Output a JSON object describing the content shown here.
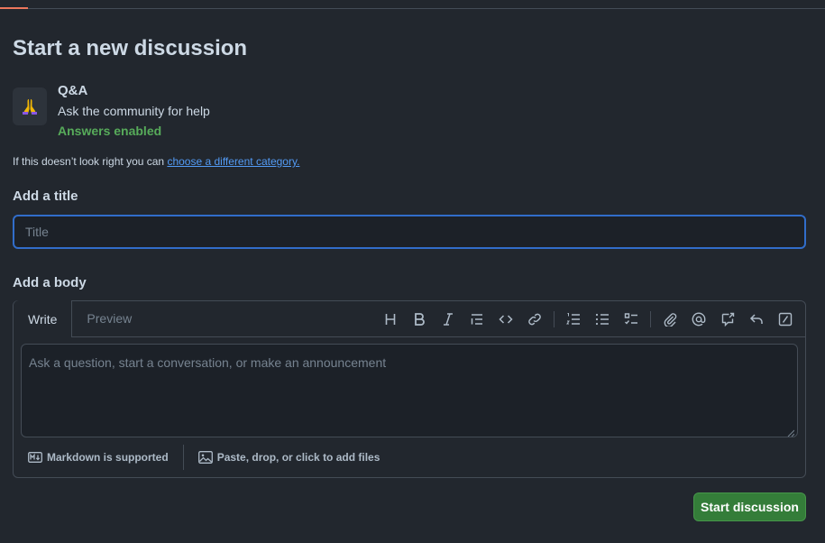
{
  "header": {
    "title": "Start a new discussion"
  },
  "category": {
    "name": "Q&A",
    "description": "Ask the community for help",
    "answers_status": "Answers enabled",
    "emoji": "🙏"
  },
  "hint": {
    "prefix": "If this doesn’t look right you can ",
    "link": "choose a different category."
  },
  "title_section": {
    "label": "Add a title",
    "placeholder": "Title",
    "value": ""
  },
  "body_section": {
    "label": "Add a body",
    "tabs": [
      {
        "label": "Write",
        "active": true
      },
      {
        "label": "Preview",
        "active": false
      }
    ],
    "placeholder": "Ask a question, start a conversation, or make an announcement",
    "value": "",
    "toolbar_icons": [
      "heading-icon",
      "bold-icon",
      "italic-icon",
      "quote-icon",
      "code-icon",
      "link-icon",
      "ordered-list-icon",
      "unordered-list-icon",
      "task-list-icon",
      "attach-icon",
      "mention-icon",
      "reference-icon",
      "reply-icon",
      "slash-command-icon"
    ],
    "markdown_note": "Markdown is supported",
    "files_note": "Paste, drop, or click to add files"
  },
  "submit": {
    "label": "Start discussion"
  },
  "colors": {
    "background": "#22272e",
    "accent_blue": "#539bf5",
    "success_green": "#57ab5a",
    "button_green": "#347d39",
    "top_accent": "#ec775c"
  }
}
